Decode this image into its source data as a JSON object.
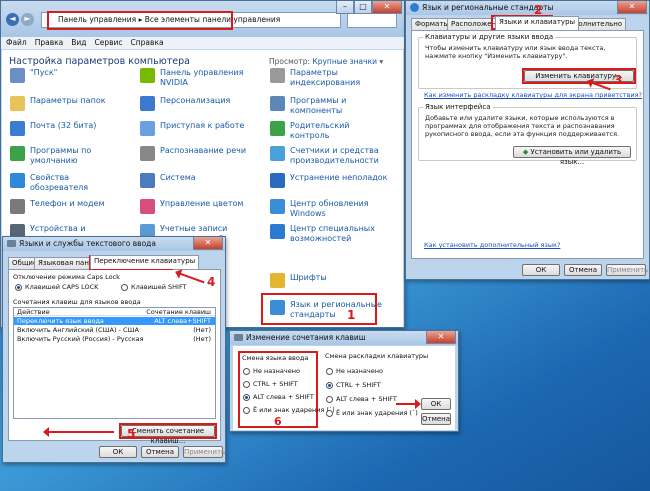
{
  "explorer": {
    "breadcrumb": [
      "Панель управления",
      "Все элементы панели управления"
    ],
    "menu": [
      "Файл",
      "Правка",
      "Вид",
      "Сервис",
      "Справка"
    ],
    "heading": "Настройка параметров компьютера",
    "view_label": "Просмотр:",
    "view_value": "Крупные значки",
    "items": [
      {
        "label": "\"Пуск\"",
        "top_cut": "панели задач и меню",
        "ico": "#6a8fc7"
      },
      {
        "label": "Параметры папок",
        "ico": "#e6c45a"
      },
      {
        "label": "Почта (32 бита)",
        "ico": "#3b7bd0"
      },
      {
        "label": "Программы по умолчанию",
        "ico": "#3ca24a"
      },
      {
        "label": "Свойства обозревателя",
        "ico": "#2e8ad8"
      },
      {
        "label": "Телефон и модем",
        "ico": "#7a7a7a"
      },
      {
        "label": "Устройства и принтеры",
        "ico": "#556677"
      },
      {
        "label": "Панель управления NVIDIA",
        "ico": "#76b900"
      },
      {
        "label": "Персонализация",
        "ico": "#3c7ad0"
      },
      {
        "label": "Приступая к работе",
        "ico": "#6aa0e0"
      },
      {
        "label": "Распознавание речи",
        "ico": "#888888"
      },
      {
        "label": "Система",
        "ico": "#4d7bbf"
      },
      {
        "label": "Управление цветом",
        "ico": "#d84f7a"
      },
      {
        "label": "Учетные записи пользователей",
        "ico": "#5a9ad6"
      },
      {
        "label": "Параметры индексирования",
        "ico": "#9a9a9a"
      },
      {
        "label": "Программы и компоненты",
        "ico": "#5d86b9"
      },
      {
        "label": "Родительский контроль",
        "ico": "#3ca24a"
      },
      {
        "label": "Счетчики и средства производительности",
        "ico": "#4aa0d8"
      },
      {
        "label": "Устранение неполадок",
        "ico": "#2a6bc0"
      },
      {
        "label": "Центр обновления Windows",
        "ico": "#3a8ed8"
      },
      {
        "label": "Центр специальных возможностей",
        "ico": "#2a7bd0"
      },
      {
        "label": "Шрифты",
        "ico": "#e4b52d"
      },
      {
        "label": "Язык и региональные стандарты",
        "ico": "#3a8ed8"
      }
    ]
  },
  "regional": {
    "title": "Язык и региональные стандарты",
    "tabs": [
      "Форматы",
      "Расположение",
      "Языки и клавиатуры",
      "Дополнительно"
    ],
    "group1_title": "Клавиатуры и другие языки ввода",
    "group1_text": "Чтобы изменить клавиатуру или язык ввода текста, нажмите кнопку \"Изменить клавиатуру\".",
    "change_kb_button": "Изменить клавиатуру...",
    "link1": "Как изменить раскладку клавиатуры для экрана приветствия?",
    "group2_title": "Язык интерфейса",
    "group2_text": "Добавьте или удалите языки, которые используются в программах для отображения текста и распознавания рукописного ввода, если эта функция поддерживается.",
    "install_button": "Установить или удалить язык...",
    "link2": "Как установить дополнительный язык?",
    "ok": "ОК",
    "cancel": "Отмена",
    "apply": "Применить"
  },
  "textsvc": {
    "title": "Языки и службы текстового ввода",
    "tabs": [
      "Общие",
      "Языковая панель",
      "Переключение клавиатуры"
    ],
    "caps_title": "Отключение режима Caps Lock",
    "caps_opt1": "Клавишей CAPS LOCK",
    "caps_opt2": "Клавишей SHIFT",
    "hotkeys_title": "Сочетания клавиш для языков ввода",
    "col_action": "Действие",
    "col_keys": "Сочетание клавиш",
    "rows": [
      {
        "action": "Переключить язык ввода",
        "keys": "ALT слева+SHIFT"
      },
      {
        "action": "Включить Английский (США) - США",
        "keys": "(Нет)"
      },
      {
        "action": "Включить Русский (Россия) - Русская",
        "keys": "(Нет)"
      }
    ],
    "change_button": "Сменить сочетание клавиш...",
    "ok": "ОК",
    "cancel": "Отмена",
    "apply": "Применить"
  },
  "hotkey": {
    "title": "Изменение сочетания клавиш",
    "left_title": "Смена языка ввода",
    "right_title": "Смена раскладки клавиатуры",
    "options": [
      "Не назначено",
      "CTRL + SHIFT",
      "ALT слева + SHIFT",
      "Ё или знак ударения (`)"
    ],
    "ok": "ОК",
    "cancel": "Отмена"
  },
  "markers": [
    "1",
    "2",
    "3",
    "4",
    "5",
    "6"
  ],
  "colors": {
    "accent_red": "#d81c1c",
    "link": "#1a5aa8"
  }
}
